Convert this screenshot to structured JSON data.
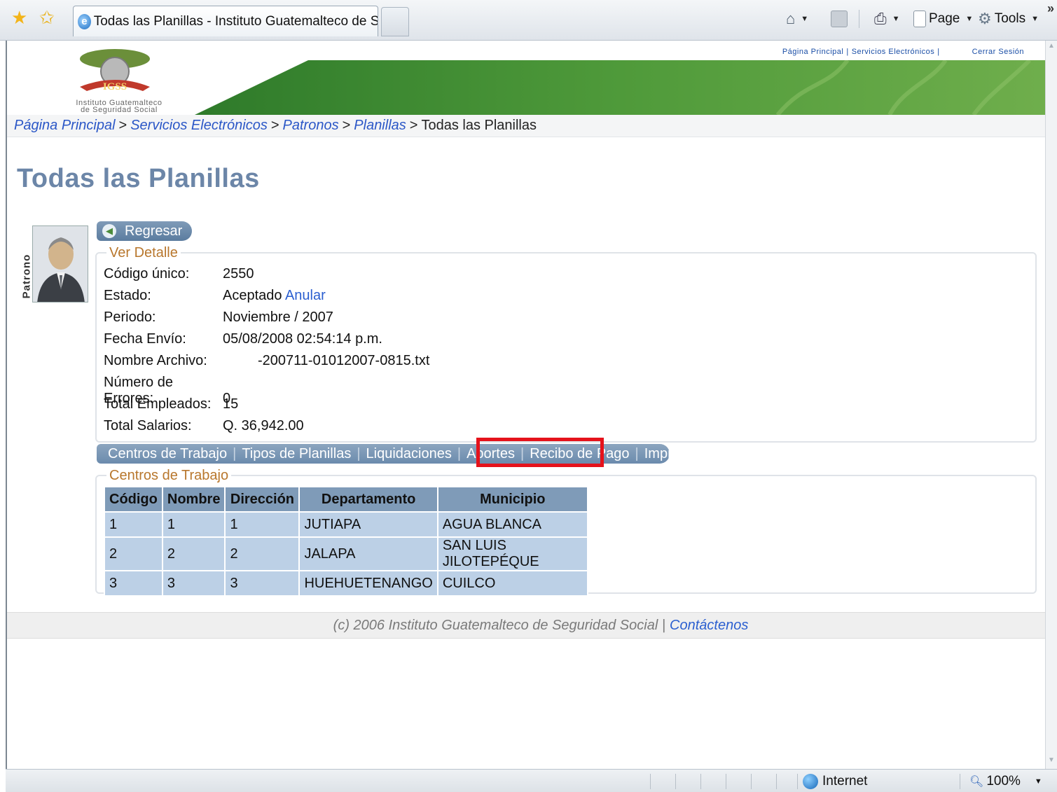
{
  "browser": {
    "tab_title": "Todas las Planillas - Instituto Guatemalteco de Segurid...",
    "toolbar": {
      "page_label": "Page",
      "tools_label": "Tools"
    },
    "status": {
      "zone": "Internet",
      "zoom": "100%"
    }
  },
  "site": {
    "logo_caption_1": "Instituto Guatemalteco",
    "logo_caption_2": "de Seguridad Social",
    "logo_text": "IGSS",
    "top_links": [
      "Página Principal",
      "Servicios Electrónicos",
      "Cerrar Sesión"
    ],
    "colors": {
      "accent_title": "#6c86a8",
      "legend": "#b8772d",
      "link": "#2b57c7",
      "highlight": "#e5121b"
    }
  },
  "breadcrumb": {
    "items": [
      "Página Principal",
      "Servicios Electrónicos",
      "Patronos",
      "Planillas"
    ],
    "current": "Todas las Planillas"
  },
  "page": {
    "title": "Todas las Planillas",
    "side_label": "Patrono",
    "back_button": "Regresar"
  },
  "detail": {
    "legend": "Ver Detalle",
    "codigo_label": "Código único:",
    "codigo_value": "2550",
    "estado_label": "Estado:",
    "estado_value": "Aceptado",
    "estado_action": "Anular",
    "periodo_label": "Periodo:",
    "periodo_value": "Noviembre / 2007",
    "fecha_label": "Fecha Envío:",
    "fecha_value": "05/08/2008 02:54:14 p.m.",
    "archivo_label": "Nombre Archivo:",
    "archivo_value": "-200711-01012007-0815.txt",
    "errores_label": "Número de Errores:",
    "errores_value": "0",
    "empleados_label": "Total Empleados:",
    "empleados_value": "15",
    "salarios_label": "Total Salarios:",
    "salarios_value": "Q. 36,942.00"
  },
  "tabs": [
    "Centros de Trabajo",
    "Tipos de Planillas",
    "Liquidaciones",
    "Aportes",
    "Recibo de Pago",
    "Impresión"
  ],
  "centros": {
    "legend": "Centros de Trabajo",
    "columns": [
      "Código",
      "Nombre",
      "Dirección",
      "Departamento",
      "Municipio"
    ],
    "rows": [
      [
        "1",
        "1",
        "1",
        "JUTIAPA",
        "AGUA BLANCA"
      ],
      [
        "2",
        "2",
        "2",
        "JALAPA",
        "SAN LUIS JILOTEPÉQUE"
      ],
      [
        "3",
        "3",
        "3",
        "HUEHUETENANGO",
        "CUILCO"
      ]
    ]
  },
  "footer": {
    "text": "(c) 2006 Instituto Guatemalteco de Seguridad Social |",
    "link": "Contáctenos"
  }
}
